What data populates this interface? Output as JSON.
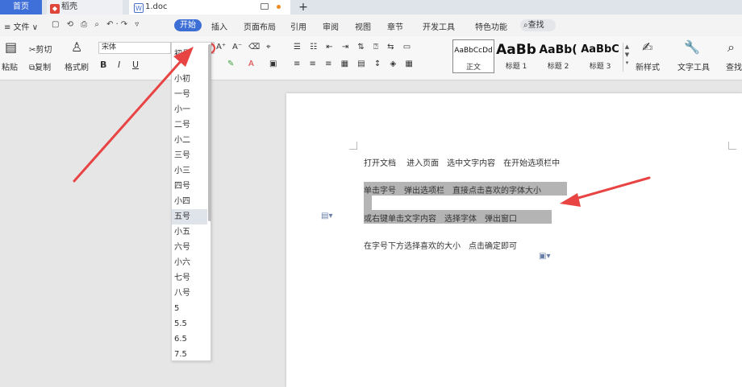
{
  "tabs": {
    "home": "首页",
    "daoke": "稻壳",
    "doc": "1.doc",
    "doc_icon": "W",
    "add": "+"
  },
  "menu": {
    "file": "≡ 文件 ∨",
    "items": [
      "开始",
      "插入",
      "页面布局",
      "引用",
      "审阅",
      "视图",
      "章节",
      "开发工具",
      "特色功能"
    ],
    "search": "查找",
    "active": "开始"
  },
  "ribbon": {
    "paste": "粘贴",
    "cut": "剪切",
    "copy": "复制",
    "format_painter": "格式刷",
    "font_name": "宋体",
    "font_size": "五号",
    "bold": "B",
    "italic": "I",
    "underline": "U",
    "grow_font": "A⁺",
    "shrink_font": "A⁻",
    "styles": [
      {
        "preview": "AaBbCcDd",
        "name": "正文"
      },
      {
        "preview": "AaBb",
        "name": "标题 1"
      },
      {
        "preview": "AaBb(",
        "name": "标题 2"
      },
      {
        "preview": "AaBbC",
        "name": "标题 3"
      }
    ],
    "new_style": "新样式",
    "text_tools": "文字工具",
    "find": "查找"
  },
  "font_size_options": [
    "初号",
    "小初",
    "一号",
    "小一",
    "二号",
    "小二",
    "三号",
    "小三",
    "四号",
    "小四",
    "五号",
    "小五",
    "六号",
    "小六",
    "七号",
    "八号",
    "5",
    "5.5",
    "6.5",
    "7.5"
  ],
  "selected_size": "五号",
  "document": {
    "lines": [
      "打开文档　 进入页面　选中文字内容　在开始选项栏中",
      "单击字号　弹出选项栏　直接点击喜欢的字体大小",
      "或右键单击文字内容　选择字体　弹出窗口",
      "在字号下方选择喜欢的大小　点击确定即可"
    ]
  },
  "colors": {
    "accent": "#3d6ed6",
    "arrow": "#e84444",
    "selection": "#b4b4b4"
  }
}
